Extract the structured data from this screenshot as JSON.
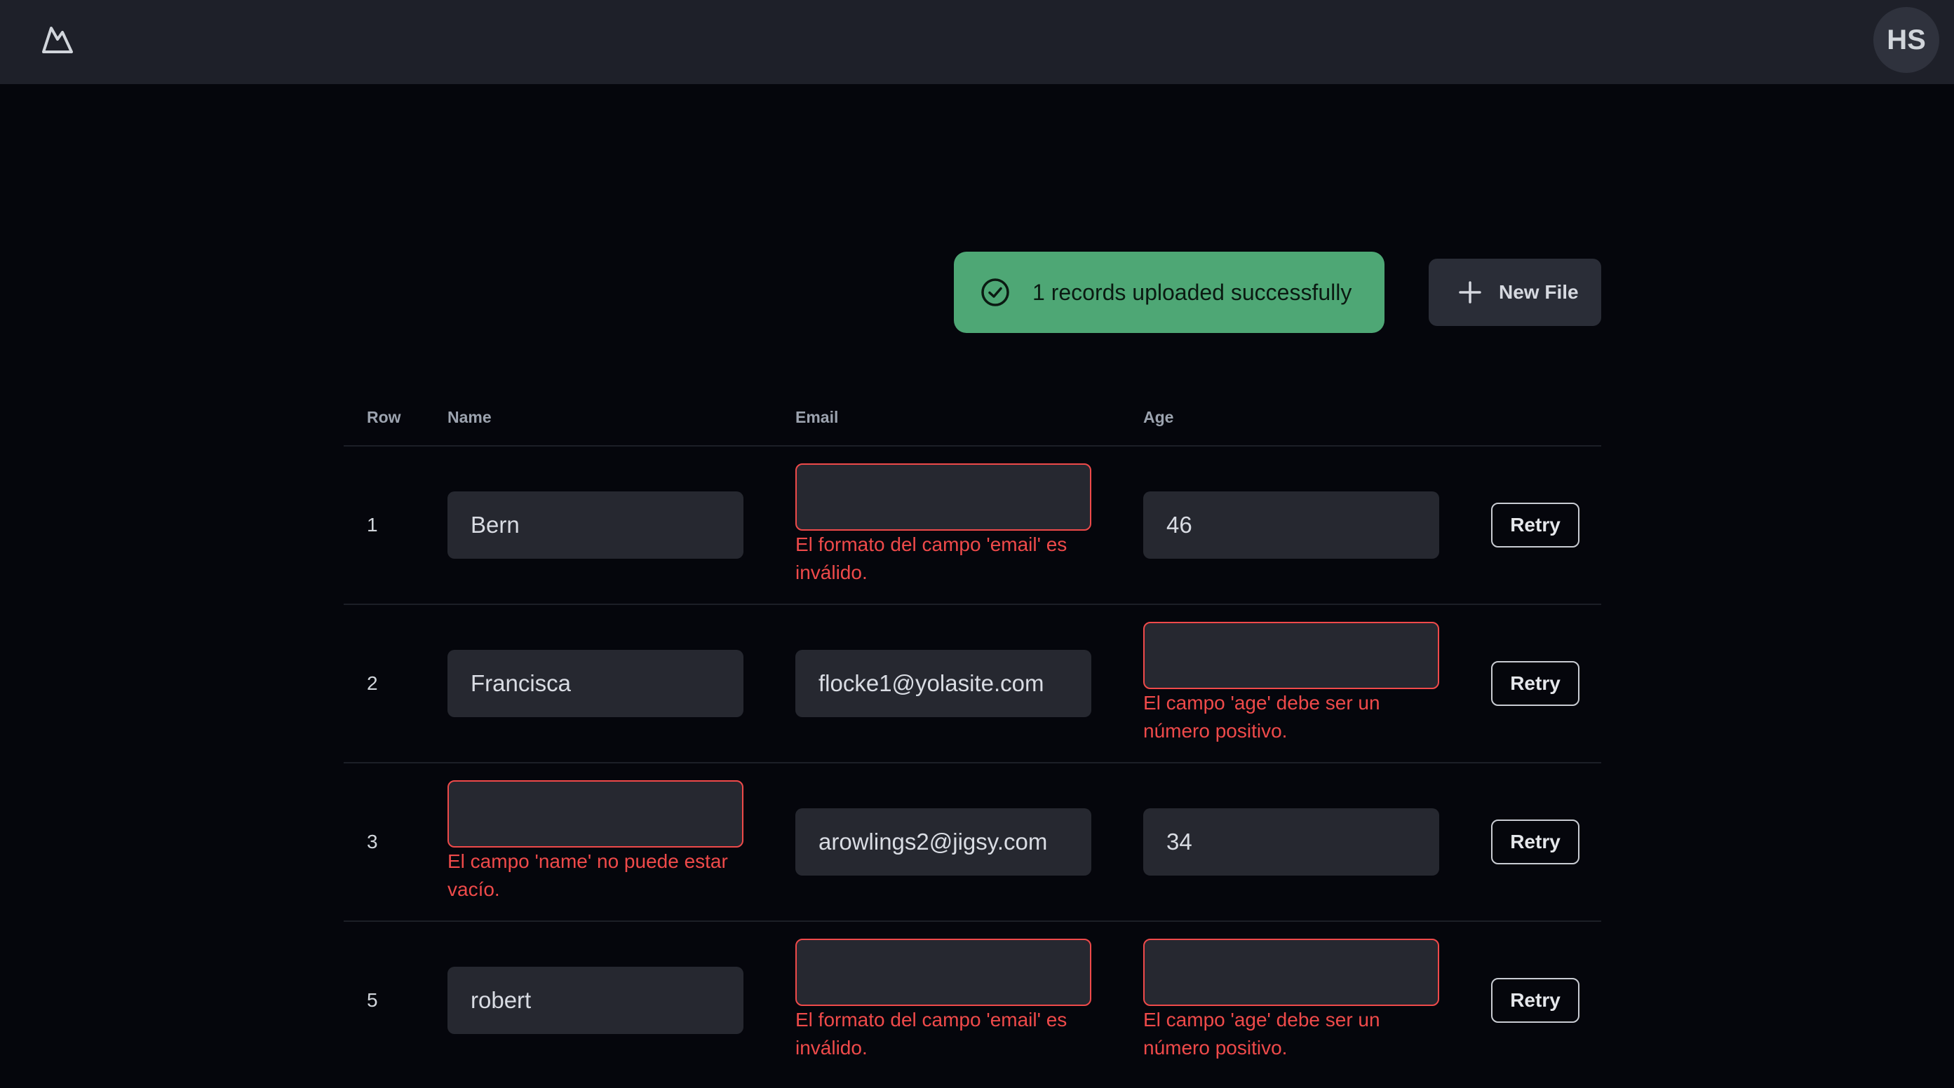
{
  "header": {
    "logo_icon": "mountain-icon",
    "avatar_initials": "HS"
  },
  "toast": {
    "icon": "check-circle-icon",
    "message": "1 records uploaded successfully",
    "color": "#4ea775"
  },
  "new_file_button": {
    "icon": "plus-icon",
    "label": "New File"
  },
  "table": {
    "columns": [
      "Row",
      "Name",
      "Email",
      "Age"
    ],
    "retry_label": "Retry",
    "error_color": "#ef4a4a",
    "rows": [
      {
        "row": "1",
        "name": {
          "value": "Bern",
          "error": ""
        },
        "email": {
          "value": "",
          "error": "El formato del campo 'email' es inválido."
        },
        "age": {
          "value": "46",
          "error": ""
        }
      },
      {
        "row": "2",
        "name": {
          "value": "Francisca",
          "error": ""
        },
        "email": {
          "value": "flocke1@yolasite.com",
          "error": ""
        },
        "age": {
          "value": "",
          "error": "El campo 'age' debe ser un número positivo."
        }
      },
      {
        "row": "3",
        "name": {
          "value": "",
          "error": "El campo 'name' no puede estar vacío."
        },
        "email": {
          "value": "arowlings2@jigsy.com",
          "error": ""
        },
        "age": {
          "value": "34",
          "error": ""
        }
      },
      {
        "row": "5",
        "name": {
          "value": "robert",
          "error": ""
        },
        "email": {
          "value": "",
          "error": "El formato del campo 'email' es inválido."
        },
        "age": {
          "value": "",
          "error": "El campo 'age' debe ser un número positivo."
        }
      }
    ]
  }
}
